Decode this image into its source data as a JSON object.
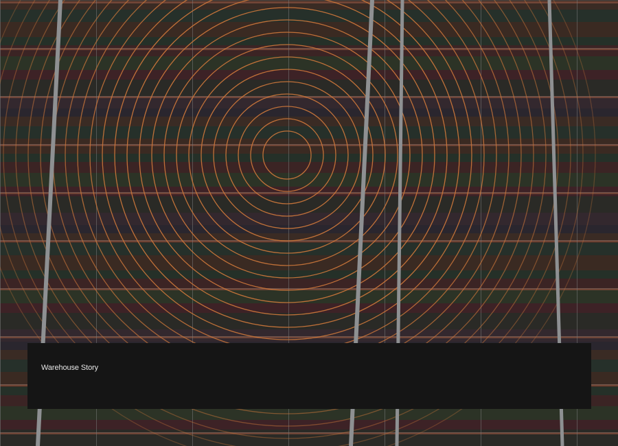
{
  "dialog": {
    "text": "Warehouse Story"
  },
  "colors": {
    "ring": "#c8753a",
    "grid": "#7a7a7a",
    "pole": "#8e9092",
    "dialog_bg": "#151515",
    "dialog_text": "#e6e6e6"
  }
}
